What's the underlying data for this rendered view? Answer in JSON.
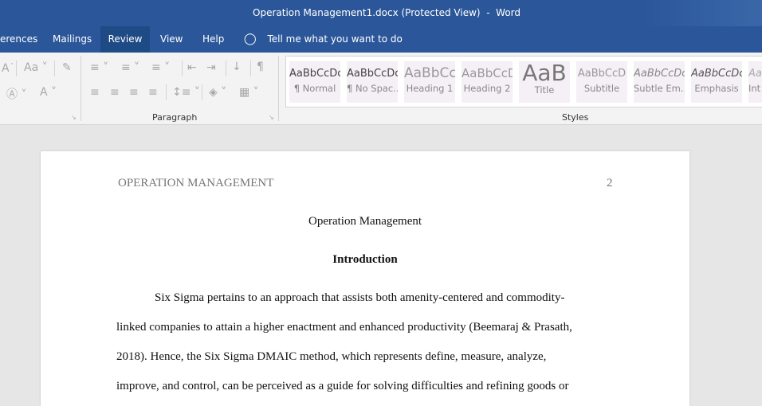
{
  "window": {
    "title": "Operation Management1.docx (Protected View)  -  Word"
  },
  "tabs": [
    {
      "label": "erences"
    },
    {
      "label": "Mailings"
    },
    {
      "label": "Review"
    },
    {
      "label": "View"
    },
    {
      "label": "Help"
    }
  ],
  "active_tab": "Review",
  "tell_me": {
    "placeholder": "Tell me what you want to do"
  },
  "ribbon": {
    "font_group": {
      "change_case": "Aa"
    },
    "paragraph_group": {
      "label": "Paragraph"
    },
    "styles_group": {
      "label": "Styles",
      "items": [
        {
          "preview": "AaBbCcDc",
          "name": "¶ Normal"
        },
        {
          "preview": "AaBbCcDc",
          "name": "¶ No Spac..."
        },
        {
          "preview": "AaBbCc",
          "name": "Heading 1"
        },
        {
          "preview": "AaBbCcD",
          "name": "Heading 2"
        },
        {
          "preview": "AaB",
          "name": "Title"
        },
        {
          "preview": "AaBbCcD",
          "name": "Subtitle"
        },
        {
          "preview": "AaBbCcDc",
          "name": "Subtle Em..."
        },
        {
          "preview": "AaBbCcDc",
          "name": "Emphasis"
        },
        {
          "preview": "Aa",
          "name": "Int"
        }
      ]
    }
  },
  "document": {
    "running_head": "OPERATION MANAGEMENT",
    "page_number": "2",
    "title": "Operation Management",
    "heading": "Introduction",
    "paragraph_lines": [
      "Six Sigma pertains to an approach that assists both amenity-centered and commodity-",
      "linked companies to attain a higher enactment and enhanced productivity (Beemaraj & Prasath,",
      "2018). Hence, the Six Sigma DMAIC method, which represents define, measure, analyze,",
      "improve, and control, can be perceived as a guide for solving difficulties and refining goods or"
    ]
  },
  "colors": {
    "brand": "#2b579a",
    "active_tab": "#1e4a85"
  }
}
